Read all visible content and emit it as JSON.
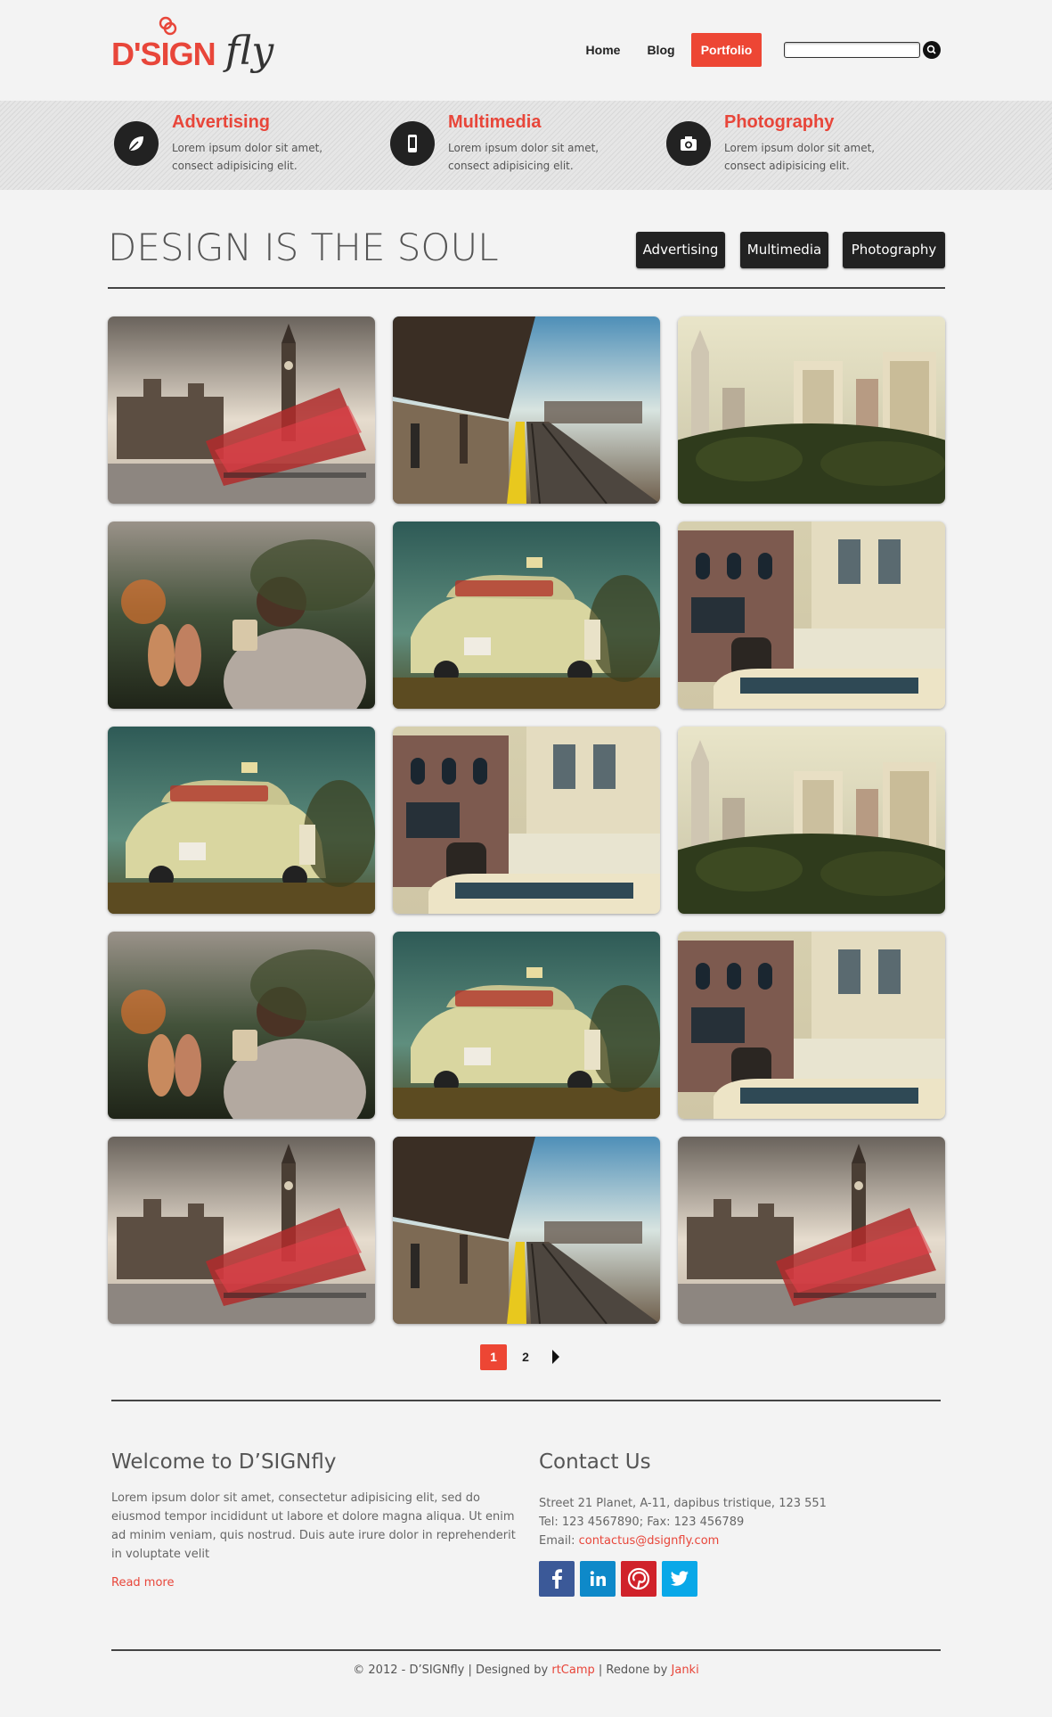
{
  "logo": {
    "dsign": "D'SIGN",
    "fly": "fly"
  },
  "nav": {
    "home": "Home",
    "blog": "Blog",
    "portfolio": "Portfolio"
  },
  "search": {
    "placeholder": ""
  },
  "features": [
    {
      "title": "Advertising",
      "text": "Lorem ipsum dolor sit amet, consect adipisicing elit.",
      "icon": "leaf-icon"
    },
    {
      "title": "Multimedia",
      "text": "Lorem ipsum dolor sit amet, consect adipisicing elit.",
      "icon": "mobile-icon"
    },
    {
      "title": "Photography",
      "text": "Lorem ipsum dolor sit amet, consect adipisicing elit.",
      "icon": "camera-icon"
    }
  ],
  "portfolio": {
    "title": "DESIGN IS THE SOUL",
    "filters": [
      "Advertising",
      "Multimedia",
      "Photography"
    ],
    "photos": [
      "london-bus",
      "train-station",
      "city-skyline",
      "photographer",
      "vintage-taxi",
      "building-van",
      "vintage-taxi",
      "building-van",
      "city-skyline",
      "photographer",
      "vintage-taxi",
      "building-van",
      "london-bus",
      "train-station",
      "london-bus"
    ]
  },
  "pagination": {
    "pages": [
      "1",
      "2"
    ],
    "current": "1"
  },
  "welcome": {
    "title": "Welcome to D’SIGNfly",
    "text": "Lorem ipsum dolor sit amet, consectetur adipisicing elit, sed do eiusmod tempor incididunt ut labore et dolore magna aliqua. Ut enim ad minim veniam, quis nostrud. Duis aute irure dolor in reprehenderit in voluptate velit",
    "read_more": "Read more"
  },
  "contact": {
    "title": "Contact Us",
    "address": "Street 21 Planet, A-11, dapibus tristique, 123 551",
    "phone": "Tel: 123 4567890; Fax: 123 456789",
    "email_label": "Email: ",
    "email": "contactus@dsignfly.com",
    "social": [
      {
        "name": "facebook",
        "color": "#3b5998"
      },
      {
        "name": "linkedin",
        "color": "#0e89c9"
      },
      {
        "name": "pinterest",
        "color": "#d0222a"
      },
      {
        "name": "twitter",
        "color": "#09a8e8"
      }
    ]
  },
  "footer": {
    "copyright": "© 2012 - D’SIGNfly | Designed by ",
    "designer": "rtCamp",
    "separator": " | Redone by ",
    "redone": "Janki"
  }
}
